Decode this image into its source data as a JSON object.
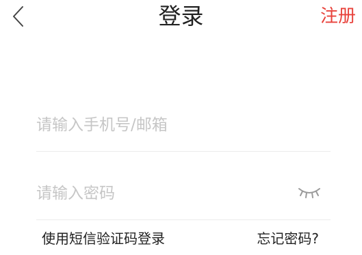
{
  "header": {
    "title": "登录",
    "register_label": "注册"
  },
  "form": {
    "phone_placeholder": "请输入手机号/邮箱",
    "phone_value": "",
    "password_placeholder": "请输入密码",
    "password_value": ""
  },
  "links": {
    "sms_login": "使用短信验证码登录",
    "forgot_password": "忘记密码?"
  },
  "icons": {
    "back": "chevron-left-icon",
    "password_visibility": "eye-closed-icon"
  },
  "colors": {
    "accent": "#e8423b",
    "text": "#222222",
    "placeholder": "#c6c6c6",
    "divider": "#ececec",
    "icon": "#9a9a9a"
  }
}
